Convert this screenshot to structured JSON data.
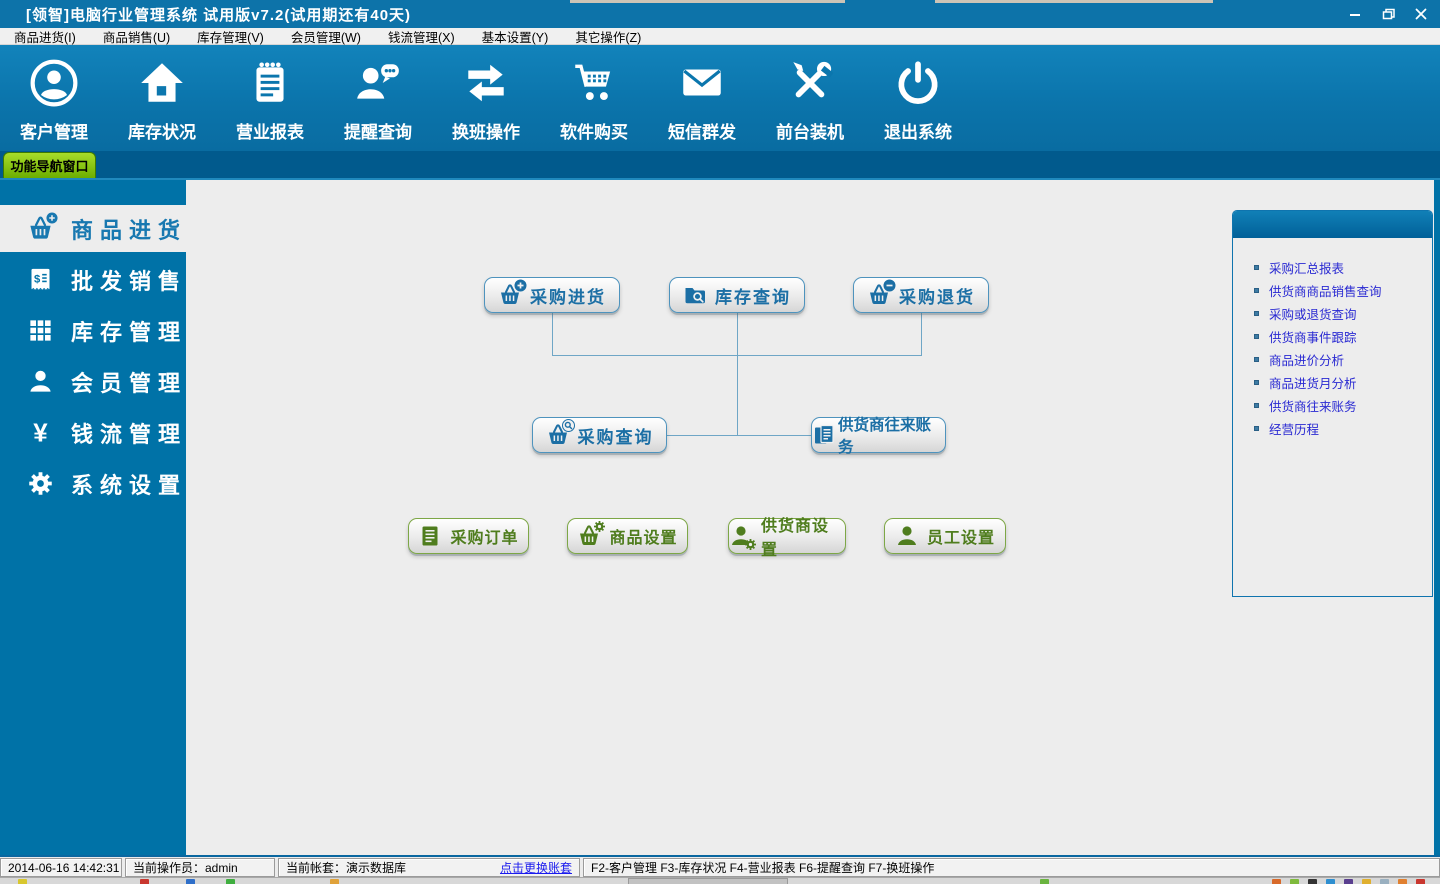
{
  "window": {
    "title": "[领智]电脑行业管理系统 试用版v7.2(试用期还有40天)"
  },
  "menu": {
    "items": [
      {
        "label": "商品进货(I)"
      },
      {
        "label": "商品销售(U)"
      },
      {
        "label": "库存管理(V)"
      },
      {
        "label": "会员管理(W)"
      },
      {
        "label": "钱流管理(X)"
      },
      {
        "label": "基本设置(Y)"
      },
      {
        "label": "其它操作(Z)"
      }
    ]
  },
  "toolbar": {
    "items": [
      {
        "label": "客户管理",
        "icon": "user-circle-icon"
      },
      {
        "label": "库存状况",
        "icon": "home-icon"
      },
      {
        "label": "营业报表",
        "icon": "report-icon"
      },
      {
        "label": "提醒查询",
        "icon": "reminder-icon"
      },
      {
        "label": "换班操作",
        "icon": "swap-arrows-icon"
      },
      {
        "label": "软件购买",
        "icon": "cart-icon"
      },
      {
        "label": "短信群发",
        "icon": "mail-icon"
      },
      {
        "label": "前台装机",
        "icon": "tools-icon"
      },
      {
        "label": "退出系统",
        "icon": "power-icon"
      }
    ]
  },
  "nav_tab": {
    "label": "功能导航窗口"
  },
  "sidebar": {
    "items": [
      {
        "label": "商品进货",
        "icon": "basket-plus-icon",
        "active": true
      },
      {
        "label": "批发销售",
        "icon": "invoice-icon"
      },
      {
        "label": "库存管理",
        "icon": "grid-icon"
      },
      {
        "label": "会员管理",
        "icon": "member-icon"
      },
      {
        "label": "钱流管理",
        "icon": "yuan-icon"
      },
      {
        "label": "系统设置",
        "icon": "gear-icon"
      }
    ]
  },
  "flowchart": {
    "row1": [
      {
        "label": "采购进货",
        "icon": "basket-plus-icon"
      },
      {
        "label": "库存查询",
        "icon": "folder-search-icon"
      },
      {
        "label": "采购退货",
        "icon": "basket-minus-icon"
      }
    ],
    "row2": [
      {
        "label": "采购查询",
        "icon": "basket-search-icon"
      },
      {
        "label": "供货商往来账务",
        "icon": "documents-icon"
      }
    ],
    "row3": [
      {
        "label": "采购订单",
        "icon": "document-icon"
      },
      {
        "label": "商品设置",
        "icon": "basket-gear-icon"
      },
      {
        "label": "供货商设置",
        "icon": "supplier-gear-icon"
      },
      {
        "label": "员工设置",
        "icon": "employee-icon"
      }
    ]
  },
  "quick_links": {
    "items": [
      {
        "label": "采购汇总报表"
      },
      {
        "label": "供货商商品销售查询"
      },
      {
        "label": "采购或退货查询"
      },
      {
        "label": "供货商事件跟踪"
      },
      {
        "label": "商品进价分析"
      },
      {
        "label": "商品进货月分析"
      },
      {
        "label": "供货商往来账务"
      },
      {
        "label": "经营历程"
      }
    ]
  },
  "status_bar": {
    "datetime": "2014-06-16 14:42:31",
    "operator": "当前操作员：admin",
    "account": "当前帐套：演示数据库",
    "switch_account_link": "点击更换账套",
    "hotkeys": "F2-客户管理 F3-库存状况 F4-营业报表 F6-提醒查询 F7-换班操作"
  },
  "colors": {
    "titlebar": "#0d73a9",
    "toolbar": "#0b76ad",
    "sidebar": "#0072a7",
    "tab_band": "#015a8d",
    "nav_tab_green": "#76b40e",
    "content_bg": "#ededed",
    "accent_blue_text": "#1c6fa5",
    "accent_green_text": "#4f7d1e",
    "link_blue": "#2a2ad2",
    "panel_border": "#0f74ae"
  }
}
